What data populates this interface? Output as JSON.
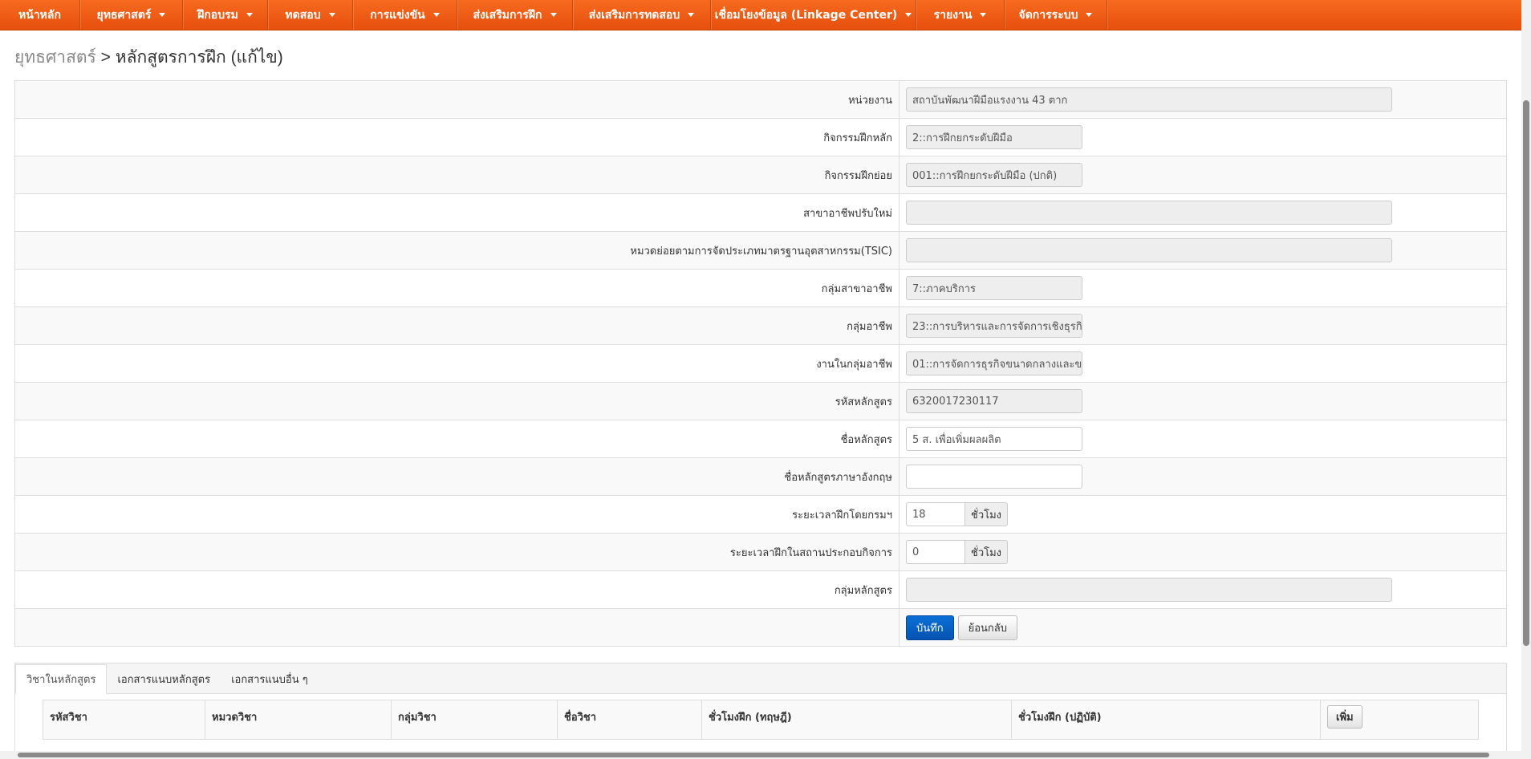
{
  "nav": {
    "items": [
      {
        "label": "หน้าหลัก",
        "dropdown": false
      },
      {
        "label": "ยุทธศาสตร์",
        "dropdown": true
      },
      {
        "label": "ฝึกอบรม",
        "dropdown": true
      },
      {
        "label": "ทดสอบ",
        "dropdown": true
      },
      {
        "label": "การแข่งขัน",
        "dropdown": true
      },
      {
        "label": "ส่งเสริมการฝึก",
        "dropdown": true
      },
      {
        "label": "ส่งเสริมการทดสอบ",
        "dropdown": true
      },
      {
        "label": "เชื่อมโยงข้อมูล (Linkage Center)",
        "dropdown": true
      },
      {
        "label": "รายงาน",
        "dropdown": true
      },
      {
        "label": "จัดการระบบ",
        "dropdown": true
      }
    ]
  },
  "breadcrumb": {
    "link": "ยุทธศาสตร์",
    "separator": " > ",
    "current": "หลักสูตรการฝึก (แก้ไข)"
  },
  "form": {
    "agency": {
      "label": "หน่วยงาน",
      "value": "สถาบันพัฒนาฝีมือแรงงาน 43 ตาก"
    },
    "main_activity": {
      "label": "กิจกรรมฝึกหลัก",
      "value": "2::การฝึกยกระดับฝีมือ"
    },
    "sub_activity": {
      "label": "กิจกรรมฝึกย่อย",
      "value": "001::การฝึกยกระดับฝีมือ (ปกติ)"
    },
    "retrain_branch": {
      "label": "สาขาอาชีพปรับใหม่",
      "value": ""
    },
    "tsic": {
      "label": "หมวดย่อยตามการจัดประเภทมาตรฐานอุตสาหกรรม(TSIC)",
      "value": ""
    },
    "career_branch_group": {
      "label": "กลุ่มสาขาอาชีพ",
      "value": "7::ภาคบริการ"
    },
    "career_group": {
      "label": "กลุ่มอาชีพ",
      "value": "23::การบริหารและการจัดการเชิงธุรกิ"
    },
    "job_in_group": {
      "label": "งานในกลุ่มอาชีพ",
      "value": "01::การจัดการธุรกิจขนาดกลางและข"
    },
    "course_code": {
      "label": "รหัสหลักสูตร",
      "value": "6320017230117"
    },
    "course_name": {
      "label": "ชื่อหลักสูตร",
      "value": "5 ส. เพื่อเพิ่มผลผลิต"
    },
    "course_name_en": {
      "label": "ชื่อหลักสูตรภาษาอังกฤษ",
      "value": ""
    },
    "dept_hours": {
      "label": "ระยะเวลาฝึกโดยกรมฯ",
      "value": "18",
      "unit": "ชั่วโมง"
    },
    "onsite_hours": {
      "label": "ระยะเวลาฝึกในสถานประกอบกิจการ",
      "value": "0",
      "unit": "ชั่วโมง"
    },
    "course_group": {
      "label": "กลุ่มหลักสูตร",
      "value": ""
    },
    "save_label": "บันทึก",
    "back_label": "ย้อนกลับ"
  },
  "tabs": [
    {
      "label": "วิชาในหลักสูตร",
      "active": true
    },
    {
      "label": "เอกสารแนบหลักสูตร",
      "active": false
    },
    {
      "label": "เอกสารแนบอื่น ๆ",
      "active": false
    }
  ],
  "subjects_table": {
    "columns": [
      "รหัสวิชา",
      "หมวดวิชา",
      "กลุ่มวิชา",
      "ชื่อวิชา",
      "ชั่วโมงฝึก (ทฤษฎี)",
      "ชั่วโมงฝึก (ปฏิบัติ)"
    ],
    "add_label": "เพิ่ม"
  },
  "colors": {
    "nav_bg": "#f05f17",
    "primary_button": "#0a63c8"
  }
}
